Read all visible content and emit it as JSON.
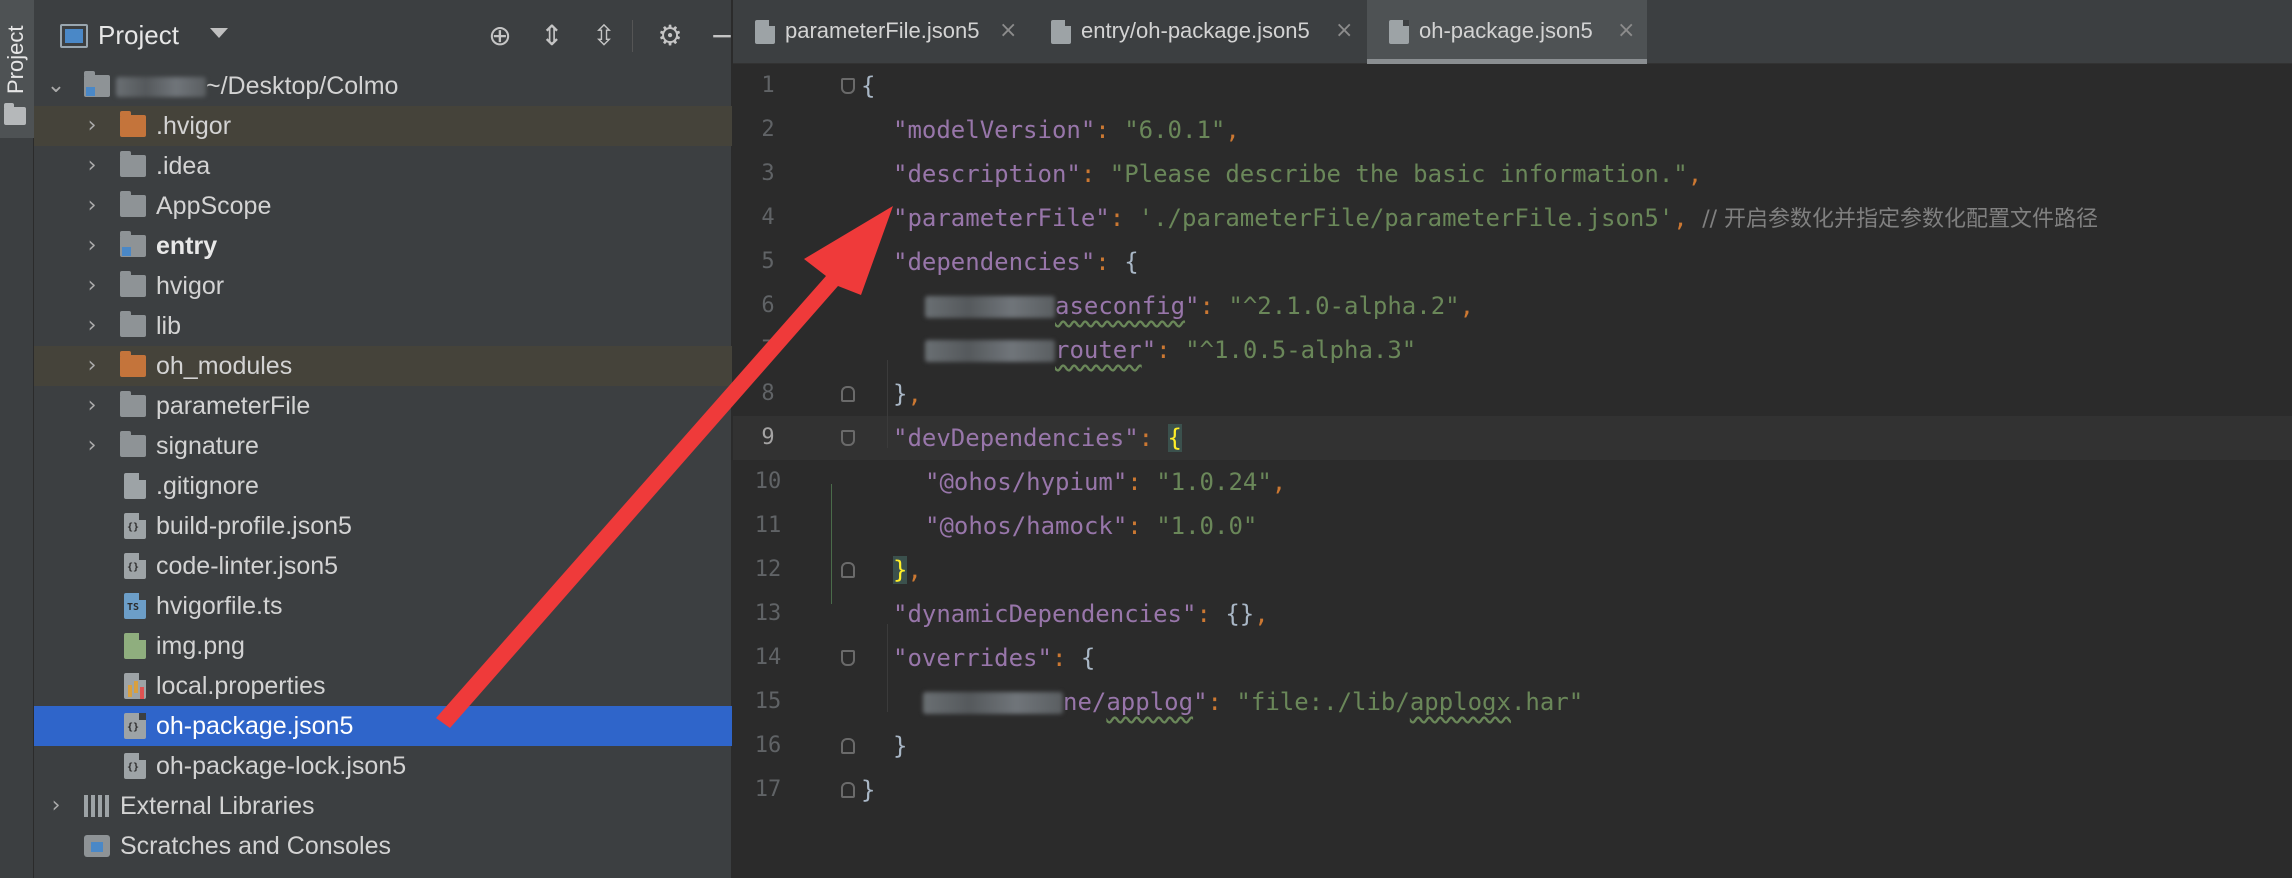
{
  "sidebar_strip": {
    "tab_label": "Project"
  },
  "project_panel": {
    "title": "Project",
    "root": {
      "path": "~/Desktop/Colmo"
    },
    "items": [
      {
        "label": ".hvigor"
      },
      {
        "label": ".idea"
      },
      {
        "label": "AppScope"
      },
      {
        "label": "entry"
      },
      {
        "label": "hvigor"
      },
      {
        "label": "lib"
      },
      {
        "label": "oh_modules"
      },
      {
        "label": "parameterFile"
      },
      {
        "label": "signature"
      },
      {
        "label": ".gitignore"
      },
      {
        "label": "build-profile.json5"
      },
      {
        "label": "code-linter.json5"
      },
      {
        "label": "hvigorfile.ts"
      },
      {
        "label": "img.png"
      },
      {
        "label": "local.properties"
      },
      {
        "label": "oh-package.json5"
      },
      {
        "label": "oh-package-lock.json5"
      },
      {
        "label": "External Libraries"
      },
      {
        "label": "Scratches and Consoles"
      }
    ]
  },
  "editor": {
    "tabs": [
      {
        "label": "parameterFile.json5"
      },
      {
        "label": "entry/oh-package.json5"
      },
      {
        "label": "oh-package.json5",
        "active": true
      }
    ],
    "line_numbers": [
      "1",
      "2",
      "3",
      "4",
      "5",
      "6",
      "7",
      "8",
      "9",
      "10",
      "11",
      "12",
      "13",
      "14",
      "15",
      "16",
      "17"
    ],
    "code": {
      "l1": "{",
      "l2_key": "\"modelVersion\"",
      "l2_val": "\"6.0.1\"",
      "l3_key": "\"description\"",
      "l3_val": "\"Please describe the basic information.\"",
      "l4_key": "\"parameterFile\"",
      "l4_val": "'./parameterFile/parameterFile.json5'",
      "l4_comment": "// 开启参数化并指定参数化配置文件路径",
      "l5_key": "\"dependencies\"",
      "l6_key_tail": "aseconfig",
      "l6_val": "\"^2.1.0-alpha.2\"",
      "l7_key_tail": "router",
      "l7_val": "\"^1.0.5-alpha.3\"",
      "l9_key": "\"devDependencies\"",
      "l10_key": "\"@ohos/hypium\"",
      "l10_val": "\"1.0.24\"",
      "l11_key": "\"@ohos/hamock\"",
      "l11_val": "\"1.0.0\"",
      "l13_key": "\"dynamicDependencies\"",
      "l14_key": "\"overrides\"",
      "l15_key_tail_a": "ne/",
      "l15_key_tail_b": "applog",
      "l15_val_a": "\"file:./lib/",
      "l15_val_b": "applogx",
      "l15_val_c": ".har\""
    }
  },
  "colors": {
    "selection": "#2f65ca",
    "annotation_arrow": "#ef3a3a",
    "json_key": "#9876aa",
    "json_string": "#6a8759",
    "punctuation": "#cc7832"
  }
}
